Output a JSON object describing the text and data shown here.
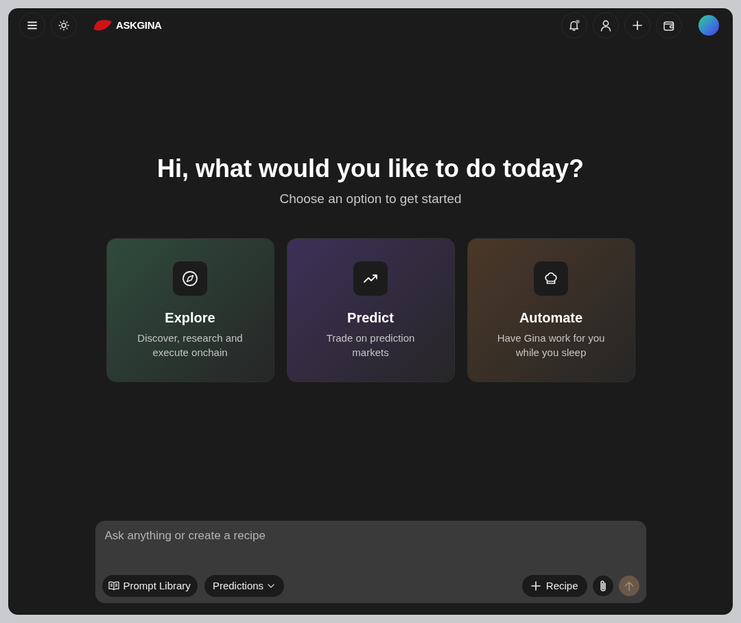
{
  "header": {
    "brand": "ASKGINA"
  },
  "greeting": {
    "title": "Hi, what would you like to do today?",
    "subtitle": "Choose an option to get started"
  },
  "cards": [
    {
      "title": "Explore",
      "description": "Discover, research and execute onchain",
      "color": "#2f4b3d"
    },
    {
      "title": "Predict",
      "description": "Trade on prediction markets",
      "color": "#3e3058"
    },
    {
      "title": "Automate",
      "description": "Have Gina work for you while you sleep",
      "color": "#4b3828"
    }
  ],
  "composer": {
    "placeholder": "Ask anything or create a recipe",
    "left_tools": [
      {
        "kind": "library",
        "label": "Prompt Library"
      },
      {
        "kind": "dropdown",
        "label": "Predictions"
      }
    ],
    "right_tools": [
      {
        "kind": "add",
        "label": "Recipe"
      }
    ],
    "send": {
      "disabled": true
    }
  }
}
